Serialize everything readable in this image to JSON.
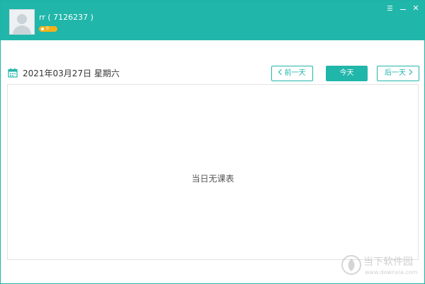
{
  "header": {
    "username": "rr ( 7126237 )",
    "badge_value": "0",
    "colors": {
      "accent": "#21b6aa",
      "badge": "#f3b11a"
    }
  },
  "window_controls": {
    "menu_icon": "menu-icon",
    "minimize_icon": "minimize-icon",
    "close_symbol": "✕"
  },
  "toolbar": {
    "date": "2021年03月27日 星期六",
    "date_icon": "calendar-icon",
    "prev_label": "前一天",
    "today_label": "今天",
    "next_label": "后一天"
  },
  "schedule": {
    "empty_message": "当日无课表"
  },
  "watermark": {
    "name": "当下软件园",
    "url": "www.downxia.com"
  }
}
